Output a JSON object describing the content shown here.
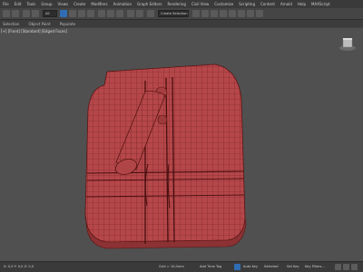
{
  "menu": [
    "File",
    "Edit",
    "Tools",
    "Group",
    "Views",
    "Create",
    "Modifiers",
    "Animation",
    "Graph Editors",
    "Rendering",
    "Civil View",
    "Customize",
    "Scripting",
    "Content",
    "Arnold",
    "Help",
    "MAXScript"
  ],
  "toolbar": {
    "selection_filter": "All",
    "named_selection": "Create Selection Se..."
  },
  "ribbon": {
    "tabs": [
      "Selection",
      "Object Paint",
      "Populate"
    ]
  },
  "viewport": {
    "label": "[+] [Front] [Standard] [Edged Faces]"
  },
  "status": {
    "coords": "X: 0,0  Y: 0,0  Z: 0,0",
    "grid": "Grid = 10,0mm",
    "add_time_tag": "Add Time Tag",
    "autokey": "Auto Key",
    "selected": "Selected",
    "set_key": "Set Key",
    "key_filters": "Key Filters..."
  },
  "colors": {
    "mesh_fill": "#b5474a",
    "mesh_wire": "#5a1414",
    "viewport_bg": "#505050",
    "accent": "#2f6db4"
  }
}
